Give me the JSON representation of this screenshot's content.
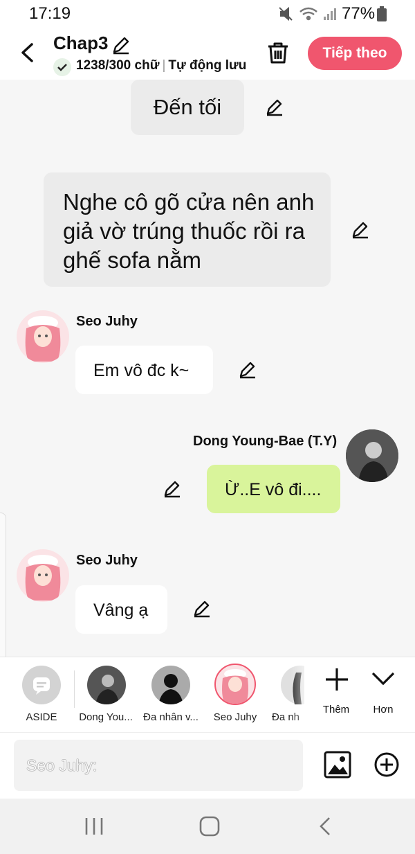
{
  "status_bar": {
    "time": "17:19",
    "battery": "77%"
  },
  "header": {
    "title": "Chap3",
    "word_count": "1238/300 chữ",
    "autosave": "Tự động lưu",
    "next_label": "Tiếp theo",
    "accent": "#f0566e"
  },
  "messages": [
    {
      "type": "narration",
      "text": "Đến tối"
    },
    {
      "type": "narration",
      "text": "Nghe cô gõ cửa nên anh giả vờ trúng thuốc rồi ra ghế sofa nằm"
    },
    {
      "type": "left",
      "speaker": "Seo Juhy",
      "text": "Em vô đc k~"
    },
    {
      "type": "right",
      "speaker": "Dong Young-Bae (T.Y)",
      "text": "Ừ..E vô đi...."
    },
    {
      "type": "left",
      "speaker": "Seo Juhy",
      "text": "Vâng ạ"
    }
  ],
  "characters": [
    {
      "label": "ASIDE",
      "icon": "aside-icon"
    },
    {
      "label": "Dong You...",
      "icon": "avatar-dong"
    },
    {
      "label": "Đa nhân v...",
      "icon": "avatar-silhouette"
    },
    {
      "label": "Seo Juhy",
      "icon": "avatar-seo"
    },
    {
      "label": "Đa nh",
      "icon": "avatar-partial"
    }
  ],
  "actions": {
    "more_label": "Thêm",
    "less_label": "Hơn"
  },
  "input": {
    "placeholder": "Seo Juhy:"
  }
}
